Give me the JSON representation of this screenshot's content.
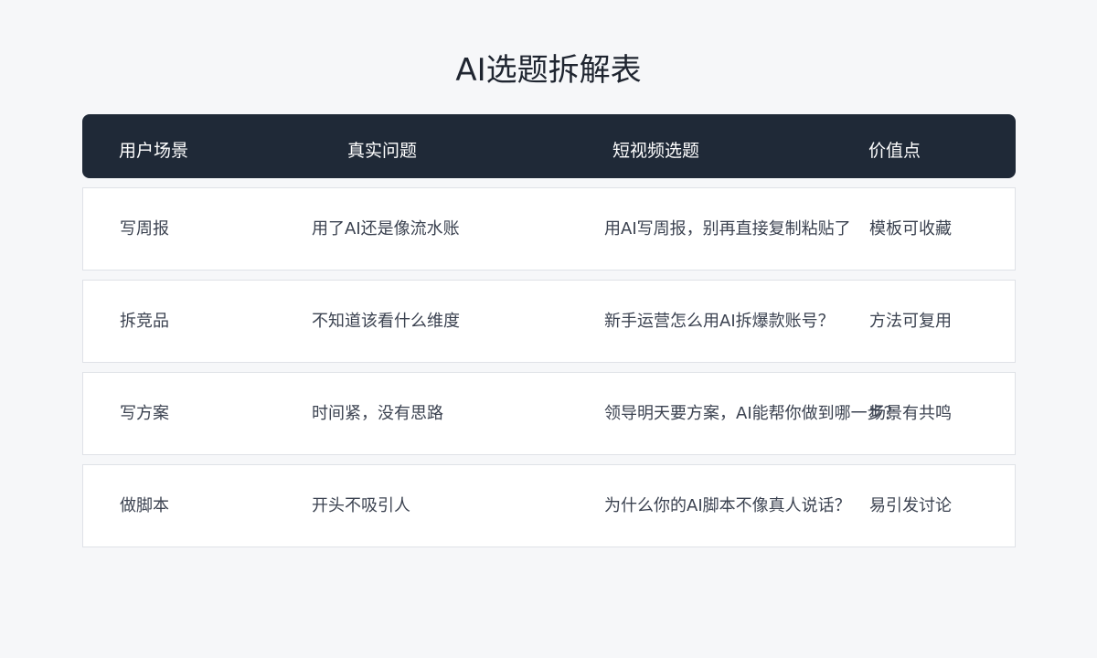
{
  "title": "AI选题拆解表",
  "table": {
    "headers": [
      "用户场景",
      "真实问题",
      "短视频选题",
      "价值点"
    ],
    "rows": [
      [
        "写周报",
        "用了AI还是像流水账",
        "用AI写周报，别再直接复制粘贴了",
        "模板可收藏"
      ],
      [
        "拆竞品",
        "不知道该看什么维度",
        "新手运营怎么用AI拆爆款账号？",
        "方法可复用"
      ],
      [
        "写方案",
        "时间紧，没有思路",
        "领导明天要方案，AI能帮你做到哪一步？",
        "场景有共鸣"
      ],
      [
        "做脚本",
        "开头不吸引人",
        "为什么你的AI脚本不像真人说话？",
        "易引发讨论"
      ]
    ]
  }
}
